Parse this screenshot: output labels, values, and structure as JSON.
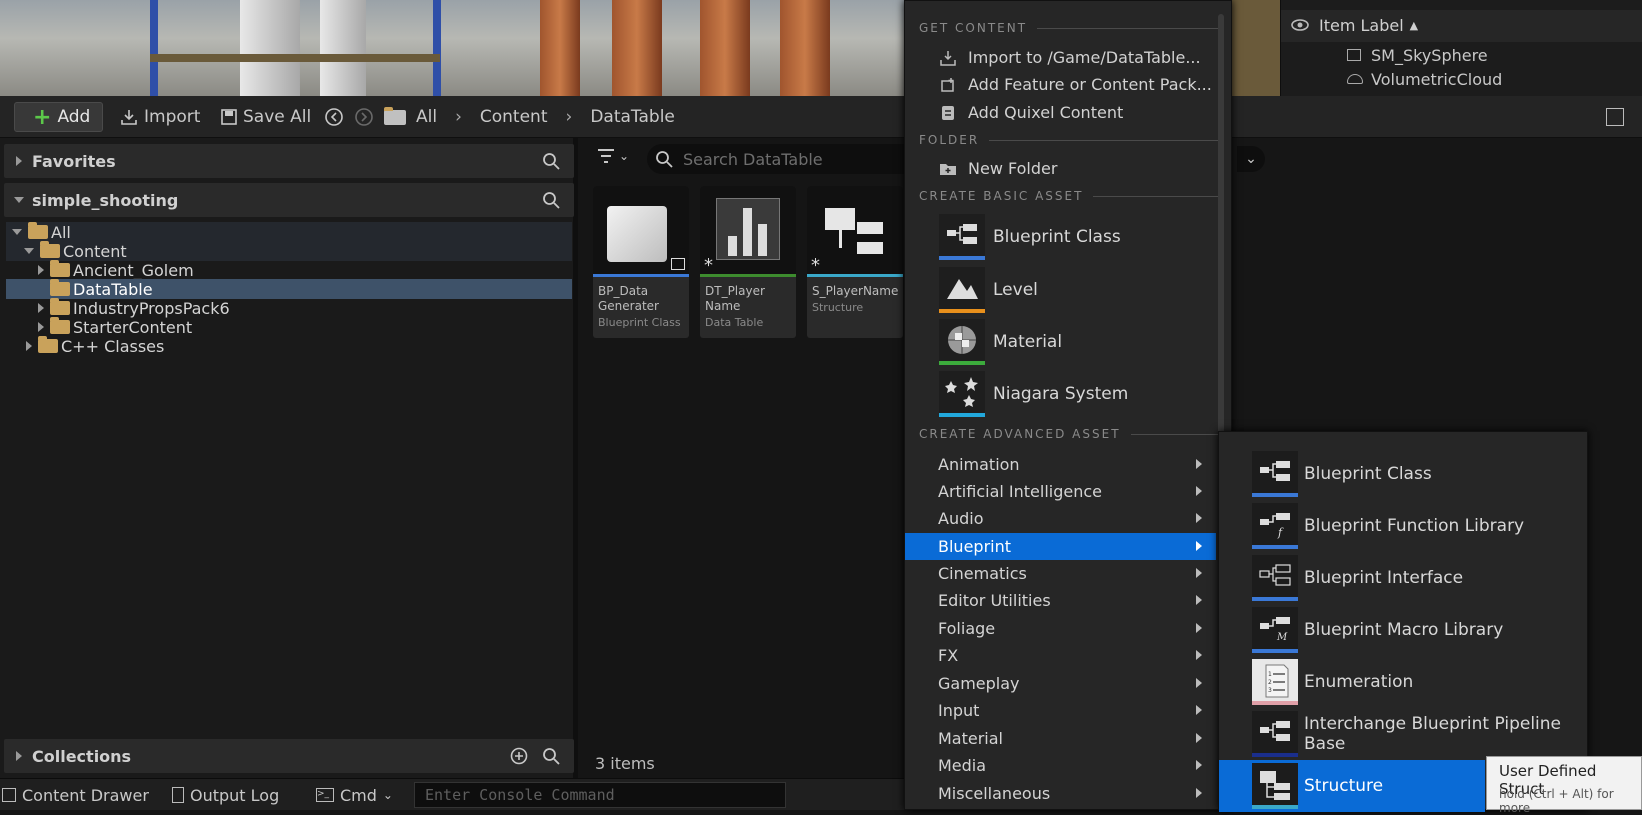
{
  "outliner": {
    "header": "Item Label",
    "rows": [
      "SM_SkySphere",
      "VolumetricCloud"
    ]
  },
  "toolbar": {
    "add_label": "Add",
    "import_label": "Import",
    "save_all_label": "Save All",
    "breadcrumbs": [
      "All",
      "Content",
      "DataTable"
    ]
  },
  "sidebar": {
    "favorites_label": "Favorites",
    "project_label": "simple_shooting",
    "tree": [
      {
        "label": "All"
      },
      {
        "label": "Content"
      },
      {
        "label": "Ancient_Golem"
      },
      {
        "label": "DataTable"
      },
      {
        "label": "IndustryPropsPack6"
      },
      {
        "label": "StarterContent"
      },
      {
        "label": "C++ Classes"
      }
    ],
    "collections_label": "Collections"
  },
  "content": {
    "search_placeholder": "Search DataTable",
    "items_count": "3 items",
    "assets": [
      {
        "name": "BP_Data Generater",
        "type": "Blueprint Class",
        "color": "#3a78d6"
      },
      {
        "name": "DT_Player Name",
        "type": "Data Table",
        "color": "#3d8c2e"
      },
      {
        "name": "S_PlayerName",
        "type": "Structure",
        "color": "#3aa8c9"
      }
    ]
  },
  "statusbar": {
    "content_drawer": "Content Drawer",
    "output_log": "Output Log",
    "cmd": "Cmd",
    "console_placeholder": "Enter Console Command"
  },
  "menu": {
    "headings": {
      "get_content": "GET CONTENT",
      "folder": "FOLDER",
      "basic": "CREATE BASIC ASSET",
      "advanced": "CREATE ADVANCED ASSET"
    },
    "get_content_items": [
      "Import to /Game/DataTable...",
      "Add Feature or Content Pack...",
      "Add Quixel Content"
    ],
    "folder_items": [
      "New Folder"
    ],
    "basic_assets": [
      {
        "label": "Blueprint Class",
        "color": "#3a78d6",
        "icon": "blueprint-icon"
      },
      {
        "label": "Level",
        "color": "#e8901c",
        "icon": "level-icon"
      },
      {
        "label": "Material",
        "color": "#3cab3c",
        "icon": "material-icon"
      },
      {
        "label": "Niagara System",
        "color": "#22a8dc",
        "icon": "niagara-icon"
      }
    ],
    "advanced_categories": [
      "Animation",
      "Artificial Intelligence",
      "Audio",
      "Blueprint",
      "Cinematics",
      "Editor Utilities",
      "Foliage",
      "FX",
      "Gameplay",
      "Input",
      "Material",
      "Media",
      "Miscellaneous"
    ],
    "selected_category": "Blueprint"
  },
  "submenu": {
    "items": [
      {
        "label": "Blueprint Class",
        "color": "#3a78d6"
      },
      {
        "label": "Blueprint Function Library",
        "color": "#3a78d6"
      },
      {
        "label": "Blueprint Interface",
        "color": "#3a78d6"
      },
      {
        "label": "Blueprint Macro Library",
        "color": "#3a78d6"
      },
      {
        "label": "Enumeration",
        "color": "#e0a0a8"
      },
      {
        "label": "Interchange Blueprint Pipeline Base",
        "color": "#1a2e8c"
      },
      {
        "label": "Structure",
        "color": "#3aa8c9"
      }
    ],
    "selected": "Structure"
  },
  "tooltip": {
    "title": "User Defined Struct",
    "hint": "hold (Ctrl + Alt) for more"
  }
}
